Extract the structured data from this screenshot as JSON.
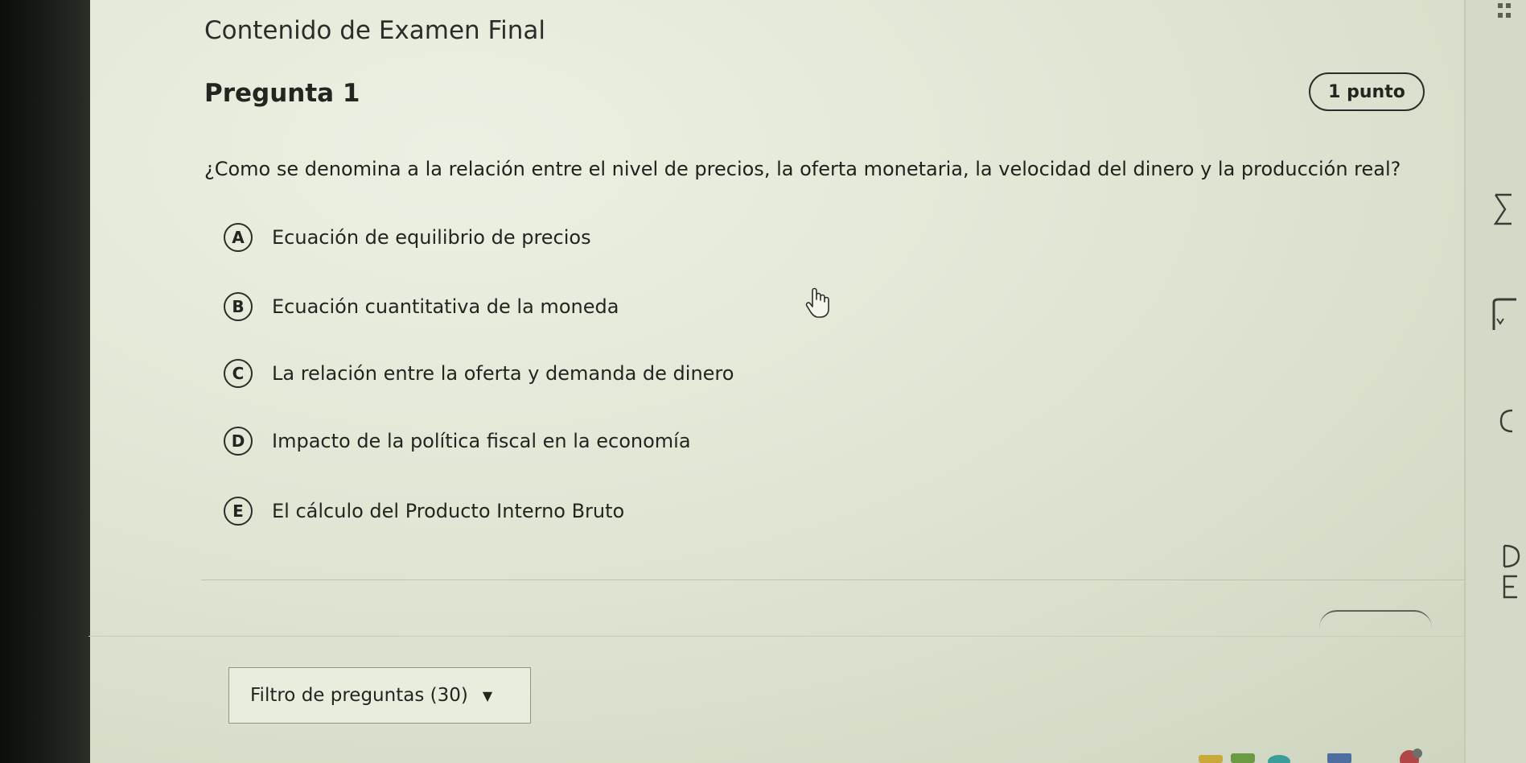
{
  "exam": {
    "title": "Contenido de Examen Final"
  },
  "question": {
    "label": "Pregunta 1",
    "points": "1 punto",
    "text": "¿Como se denomina a la relación entre el nivel de precios, la oferta monetaria, la velocidad del dinero y la producción real?",
    "options": [
      {
        "letter": "A",
        "text": "Ecuación de equilibrio de precios"
      },
      {
        "letter": "B",
        "text": "Ecuación cuantitativa de la moneda"
      },
      {
        "letter": "C",
        "text": "La relación entre la oferta y demanda de dinero"
      },
      {
        "letter": "D",
        "text": "Impacto de la política fiscal en la economía"
      },
      {
        "letter": "E",
        "text": "El cálculo del Producto Interno Bruto"
      }
    ]
  },
  "filter": {
    "label": "Filtro de preguntas (30)",
    "caret": "▼"
  },
  "colors": {
    "page_background": "#e3e8d7",
    "text": "#232620"
  },
  "icons": {
    "cursor": "hand-pointer-icon"
  }
}
